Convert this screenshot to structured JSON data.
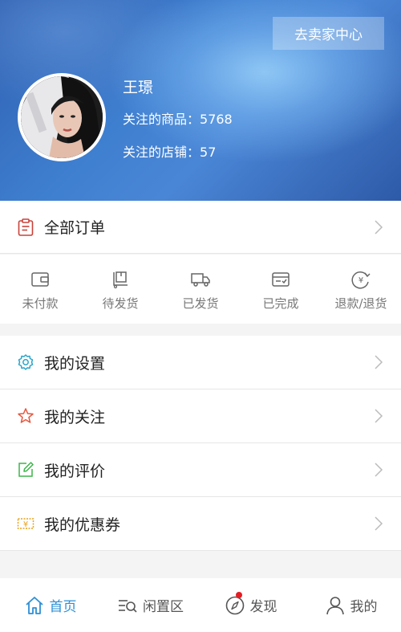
{
  "header": {
    "seller_button": "去卖家中心",
    "user_name": "王璟",
    "followed_goods_label": "关注的商品：",
    "followed_goods_count": "5768",
    "followed_shops_label": "关注的店铺：",
    "followed_shops_count": "57"
  },
  "orders": {
    "title": "全部订单",
    "statuses": [
      {
        "label": "未付款",
        "icon": "wallet-icon"
      },
      {
        "label": "待发货",
        "icon": "package-icon"
      },
      {
        "label": "已发货",
        "icon": "truck-icon"
      },
      {
        "label": "已完成",
        "icon": "completed-box-icon"
      },
      {
        "label": "退款/退货",
        "icon": "refund-icon"
      }
    ]
  },
  "menu": [
    {
      "label": "我的设置",
      "icon": "gear-icon",
      "color": "#2aa4c9"
    },
    {
      "label": "我的关注",
      "icon": "star-icon",
      "color": "#e8553a"
    },
    {
      "label": "我的评价",
      "icon": "pencil-icon",
      "color": "#3cb54a"
    },
    {
      "label": "我的优惠券",
      "icon": "coupon-icon",
      "color": "#e8a21c"
    }
  ],
  "tabbar": [
    {
      "label": "首页",
      "icon": "home-icon",
      "active": true
    },
    {
      "label": "闲置区",
      "icon": "list-search-icon",
      "active": false
    },
    {
      "label": "发现",
      "icon": "compass-icon",
      "active": false
    },
    {
      "label": "我的",
      "icon": "person-icon",
      "active": false
    }
  ],
  "colors": {
    "accent": "#2d8fd5",
    "badge": "#e51c23",
    "order_icon": "#c9423a"
  }
}
